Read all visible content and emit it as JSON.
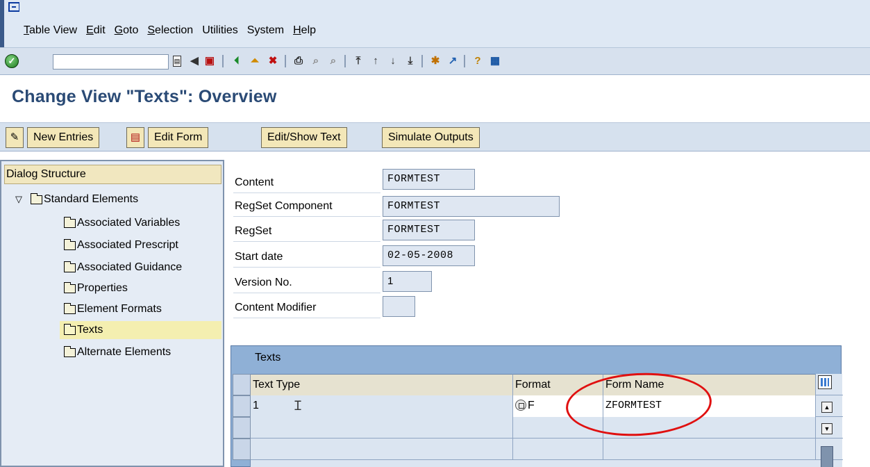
{
  "menu": {
    "items": [
      "Table View",
      "Edit",
      "Goto",
      "Selection",
      "Utilities",
      "System",
      "Help"
    ]
  },
  "toolbar": {
    "command_value": ""
  },
  "title": "Change View \"Texts\": Overview",
  "app_toolbar": {
    "new_entries": "New Entries",
    "edit_form": "Edit Form",
    "edit_show_text": "Edit/Show Text",
    "simulate_outputs": "Simulate Outputs"
  },
  "dialog_structure": {
    "header": "Dialog Structure",
    "root": "Standard Elements",
    "items": [
      "Associated Variables",
      "Associated Prescript",
      "Associated Guidance",
      "Properties",
      "Element Formats",
      "Texts",
      "Alternate Elements"
    ],
    "selected": "Texts"
  },
  "fields": {
    "content": {
      "label": "Content",
      "value": "FORMTEST"
    },
    "regset_component": {
      "label": "RegSet Component",
      "value": "FORMTEST"
    },
    "regset": {
      "label": "RegSet",
      "value": "FORMTEST"
    },
    "start_date": {
      "label": "Start date",
      "value": "02-05-2008"
    },
    "version_no": {
      "label": "Version No.",
      "value": "1"
    },
    "content_modifier": {
      "label": "Content Modifier",
      "value": ""
    }
  },
  "texts_table": {
    "title": "Texts",
    "columns": [
      "Text Type",
      "Format",
      "Form Name"
    ],
    "rows": [
      {
        "text_type": "1",
        "format": "F",
        "form_name": "ZFORMTEST"
      },
      {
        "text_type": "",
        "format": "",
        "form_name": ""
      },
      {
        "text_type": "",
        "format": "",
        "form_name": ""
      }
    ]
  },
  "colors": {
    "title": "#2a4a75",
    "button_bg": "#f3e7b8",
    "annotation": "#e01010"
  }
}
